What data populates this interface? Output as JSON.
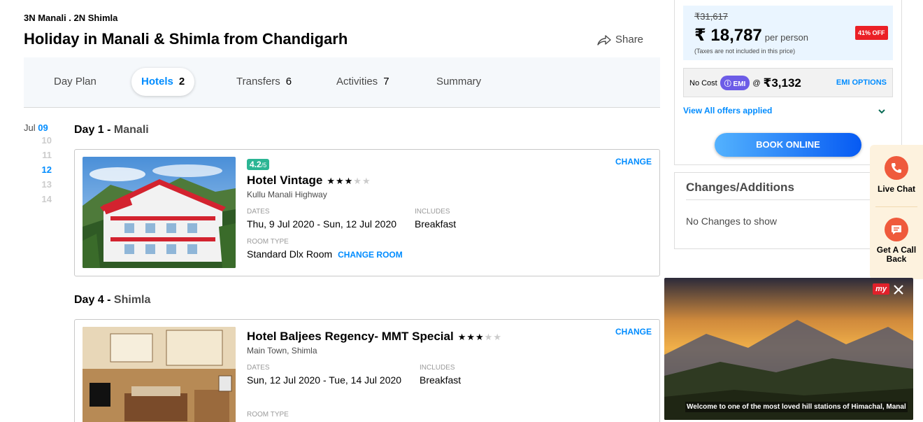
{
  "header": {
    "subtitle": "3N Manali . 2N Shimla",
    "title": "Holiday in Manali & Shimla from Chandigarh",
    "share_label": "Share"
  },
  "tabs": [
    {
      "label": "Day Plan",
      "count": ""
    },
    {
      "label": "Hotels",
      "count": "2",
      "active": true
    },
    {
      "label": "Transfers",
      "count": "6"
    },
    {
      "label": "Activities",
      "count": "7"
    },
    {
      "label": "Summary",
      "count": ""
    }
  ],
  "dates": {
    "month": "Jul",
    "first_day": "09",
    "days": [
      "10",
      "11",
      "12",
      "13",
      "14"
    ]
  },
  "days": [
    {
      "label": "Day 1 - ",
      "place": "Manali",
      "hotel": {
        "rating": "4.2",
        "rating_suffix": "/5",
        "name": "Hotel Vintage",
        "stars_on": "★★★",
        "stars_off": "★★",
        "location": "Kullu Manali Highway",
        "dates_label": "DATES",
        "dates_value": "Thu, 9 Jul 2020 - Sun, 12 Jul 2020",
        "includes_label": "INCLUDES",
        "includes_value": "Breakfast",
        "room_type_label": "ROOM TYPE",
        "room_type_value": "Standard Dlx Room",
        "change_room_label": "CHANGE ROOM",
        "change_label": "CHANGE"
      }
    },
    {
      "label": "Day 4 - ",
      "place": "Shimla",
      "hotel": {
        "name": "Hotel Baljees Regency- MMT Special",
        "stars_on": "★★★",
        "stars_off": "★★",
        "location": "Main Town, Shimla",
        "dates_label": "DATES",
        "dates_value": "Sun, 12 Jul 2020 - Tue, 14 Jul 2020",
        "includes_label": "INCLUDES",
        "includes_value": "Breakfast",
        "room_type_label": "ROOM TYPE",
        "change_label": "CHANGE"
      }
    }
  ],
  "pricing": {
    "old_price": "₹31,617",
    "new_price": "₹ 18,787",
    "per_person": "per person",
    "tax_note": "(Taxes are not included in this price)",
    "off_badge": "41% OFF",
    "emi_prefix": "No Cost",
    "emi_pill": "EMI",
    "emi_at": "@",
    "emi_amount": "₹3,132",
    "emi_options": "EMI OPTIONS",
    "offers_label": "View All offers applied",
    "book_label": "BOOK ONLINE"
  },
  "changes": {
    "title": "Changes/Additions",
    "empty": "No Changes to show"
  },
  "help": {
    "live_chat": "Live Chat",
    "call_back_1": "Get A Call",
    "call_back_2": "Back"
  },
  "video": {
    "logo": "my",
    "caption": "Welcome to one of the most loved hill stations of Himachal, Manal"
  },
  "colors": {
    "accent": "#008cff",
    "rating_green": "#2bb594",
    "offer_red": "#eb2026",
    "help_orange": "#ef5a3c"
  }
}
